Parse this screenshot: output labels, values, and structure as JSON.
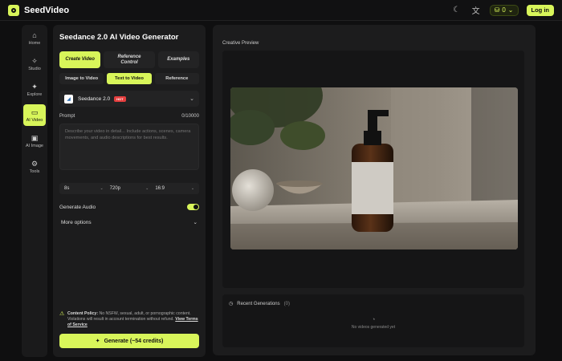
{
  "brand": {
    "name": "SeedVideo"
  },
  "topbar": {
    "credits": "0",
    "login_label": "Log in"
  },
  "nav": [
    {
      "label": "Home",
      "icon": "home-icon",
      "glyph": "⌂"
    },
    {
      "label": "Studio",
      "icon": "wand-icon",
      "glyph": "✧"
    },
    {
      "label": "Explore",
      "icon": "sparkle-icon",
      "glyph": "✦"
    },
    {
      "label": "AI Video",
      "icon": "video-icon",
      "glyph": "▭"
    },
    {
      "label": "AI Image",
      "icon": "image-icon",
      "glyph": "▣"
    },
    {
      "label": "Tools",
      "icon": "tools-icon",
      "glyph": "⚙"
    }
  ],
  "panel": {
    "title": "Seedance 2.0 AI Video Generator",
    "mode_tabs": [
      "Create Video",
      "Reference Control",
      "Examples"
    ],
    "sub_tabs": [
      "Image to Video",
      "Text to Video",
      "Reference"
    ],
    "model": {
      "name": "Seedance 2.0",
      "badge": "HOT"
    },
    "prompt_label": "Prompt",
    "prompt_counter": "0/10000",
    "prompt_placeholder": "Describe your video in detail... Include actions, scenes, camera movements, and audio descriptions for best results.",
    "params": {
      "duration": "8s",
      "resolution": "720p",
      "ratio": "16:9"
    },
    "audio_label": "Generate Audio",
    "audio_enabled": true,
    "more_label": "More options",
    "policy": {
      "title": "Content Policy:",
      "text": " No NSFW, sexual, adult, or pornographic content. Violations will result in account termination without refund. ",
      "link": "View Terms of Service"
    },
    "generate_label": "Generate (~54 credits)"
  },
  "preview": {
    "label": "Creative Preview",
    "recent_title": "Recent Generations",
    "recent_count": "(0)",
    "empty_text": "No videos generated yet"
  },
  "colors": {
    "accent": "#d8f55a",
    "panel": "#1c1c1d",
    "background": "#0f0f10"
  }
}
